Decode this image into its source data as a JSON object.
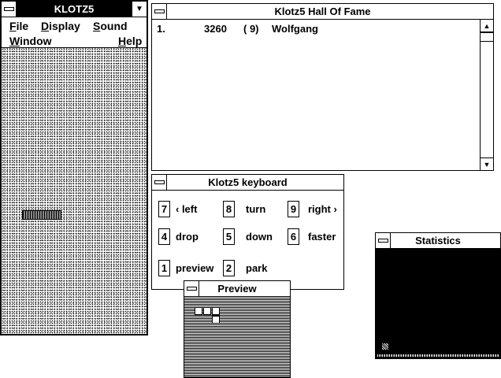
{
  "game_window": {
    "title": "KLOTZ5",
    "menus": [
      {
        "label": "File",
        "underline": "F",
        "rest": "ile"
      },
      {
        "label": "Display",
        "underline": "D",
        "rest": "isplay"
      },
      {
        "label": "Sound",
        "underline": "S",
        "rest": "ound"
      },
      {
        "label": "Window",
        "underline": "W",
        "rest": "indow"
      },
      {
        "label": "Help",
        "underline": "H",
        "rest": "elp"
      }
    ]
  },
  "hall_of_fame": {
    "title": "Klotz5 Hall Of Fame",
    "entries": [
      {
        "rank": "1.",
        "score": "3260",
        "level": "( 9)",
        "name": "Wolfgang"
      }
    ]
  },
  "keyboard": {
    "title": "Klotz5 keyboard",
    "keys": [
      {
        "key": "7",
        "label": "‹ left"
      },
      {
        "key": "8",
        "label": "turn"
      },
      {
        "key": "9",
        "label": "right ›"
      },
      {
        "key": "4",
        "label": "drop"
      },
      {
        "key": "5",
        "label": "down"
      },
      {
        "key": "6",
        "label": "faster"
      },
      {
        "key": "1",
        "label": "preview"
      },
      {
        "key": "2",
        "label": "park"
      }
    ]
  },
  "preview": {
    "title": "Preview"
  },
  "statistics": {
    "title": "Statistics"
  }
}
